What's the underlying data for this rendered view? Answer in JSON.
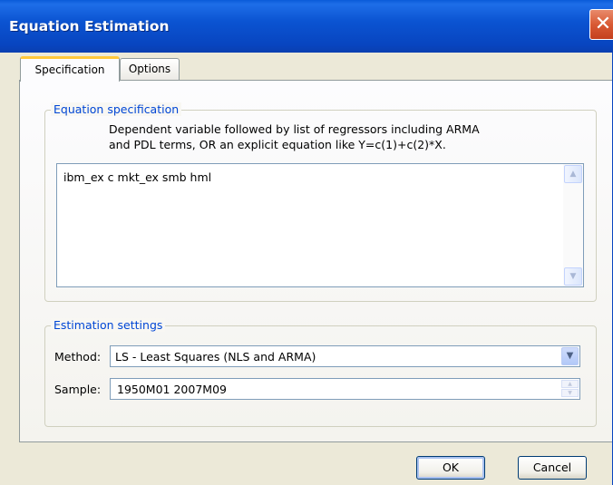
{
  "window": {
    "title": "Equation Estimation",
    "close_glyph": "✕",
    "close_icon": "close-icon"
  },
  "tabs": [
    {
      "label": "Specification",
      "active": true
    },
    {
      "label": "Options",
      "active": false
    }
  ],
  "equation_spec": {
    "legend": "Equation specification",
    "description_line1": "Dependent variable followed by list of regressors including ARMA",
    "description_line2": "and PDL terms, OR an explicit equation like Y=c(1)+c(2)*X.",
    "value": "ibm_ex c mkt_ex smb hml"
  },
  "estimation_settings": {
    "legend": "Estimation settings",
    "method_label": "Method:",
    "method_value": "LS  -  Least Squares (NLS and ARMA)",
    "sample_label": "Sample:",
    "sample_value": "1950M01 2007M09"
  },
  "buttons": {
    "ok": "OK",
    "cancel": "Cancel"
  },
  "colors": {
    "title_bar": "#0845c0",
    "legend_text": "#0046d5",
    "tab_highlight": "#ffc83c",
    "dialog_bg": "#ece9d8"
  }
}
